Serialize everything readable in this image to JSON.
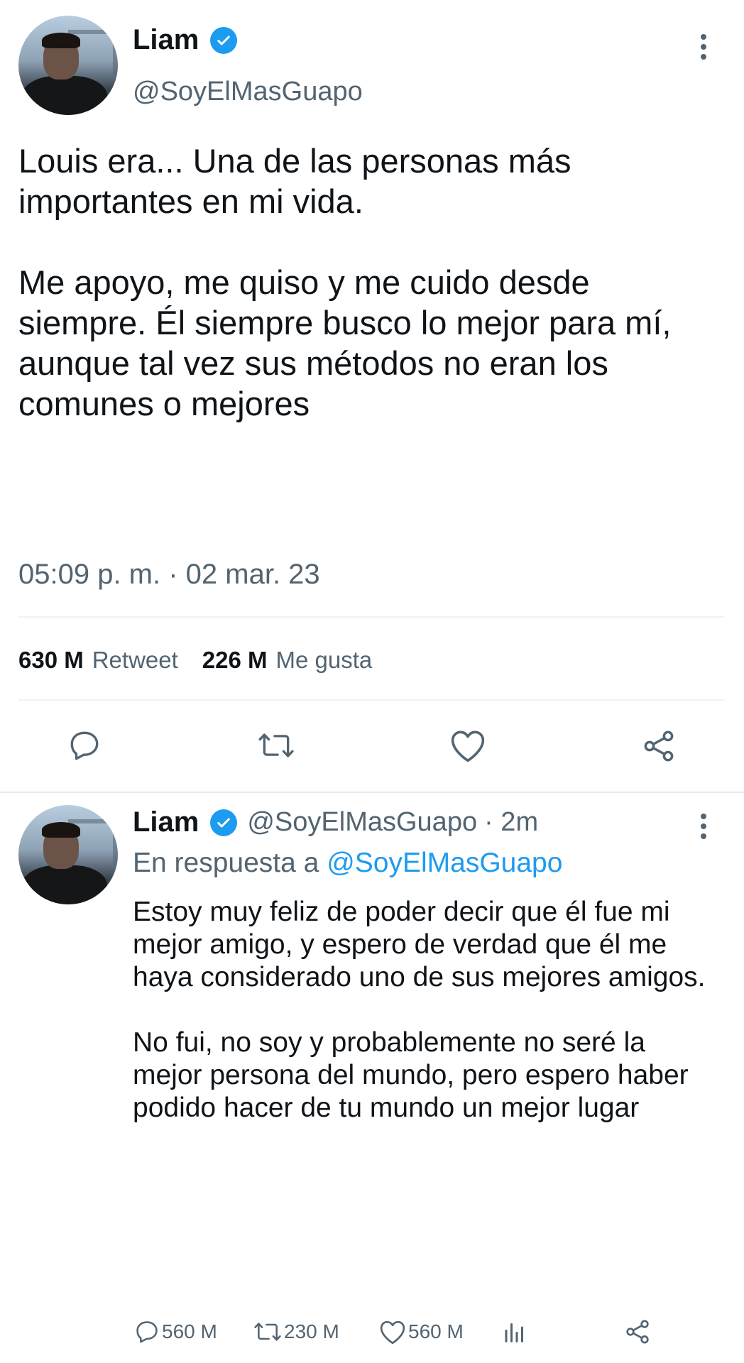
{
  "main_tweet": {
    "author_name": "Liam",
    "author_handle": "@SoyElMasGuapo",
    "text": "Louis era... Una de las personas más importantes en mi vida.\n\nMe apoyo, me quiso y me cuido desde siempre. Él siempre busco lo mejor para mí, aunque tal vez sus métodos no eran los comunes o mejores",
    "timestamp": "05:09 p. m. · 02 mar. 23",
    "retweets_count": "630 M",
    "retweets_label": "Retweet",
    "likes_count": "226 M",
    "likes_label": "Me gusta",
    "icons": [
      "reply-icon",
      "retweet-icon",
      "like-icon",
      "share-icon"
    ]
  },
  "reply_tweet": {
    "author_name": "Liam",
    "author_handle": "@SoyElMasGuapo",
    "time_ago": "· 2m",
    "reply_prefix": "En respuesta a",
    "reply_mention": "@SoyElMasGuapo",
    "text": "Estoy muy feliz de poder decir que él fue mi mejor amigo, y espero de verdad que él me haya considerado uno de sus mejores amigos.\n\nNo fui, no soy y probablemente no seré la mejor persona del mundo, pero espero haber podido hacer de tu mundo un mejor lugar",
    "reply_count": "560 M",
    "retweet_count": "230 M",
    "like_count": "560 M"
  },
  "colors": {
    "accent": "#1d9bf0",
    "secondary_text": "#536471",
    "divider": "#eff3f4"
  }
}
